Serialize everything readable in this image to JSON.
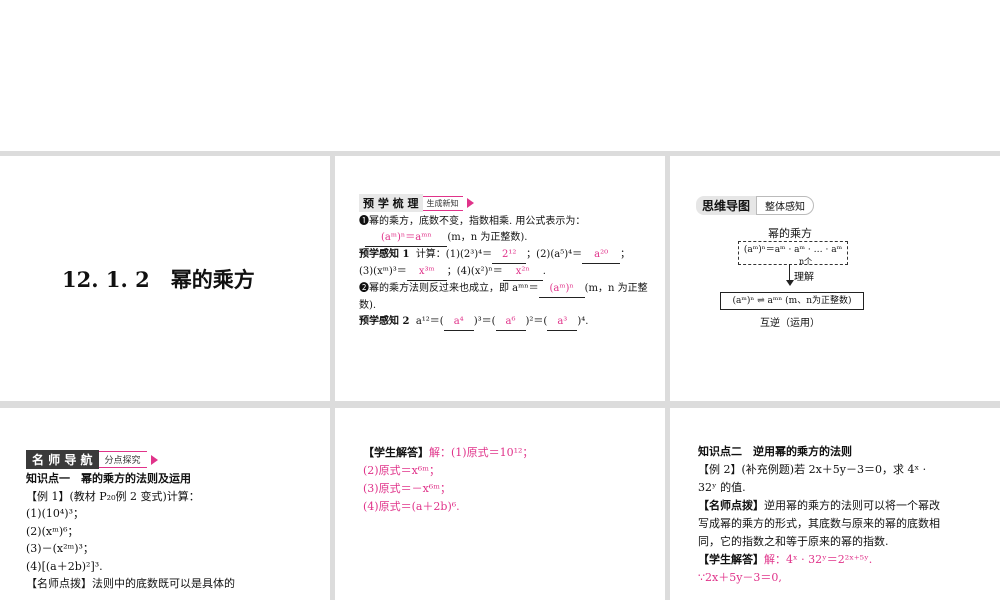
{
  "slide1": {
    "title": "12. 1. 2　幂的乘方"
  },
  "slide2": {
    "tag_main": "预 学 梳 理",
    "tag_sub": "生成新知",
    "point1": "❶幂的乘方，底数不变，指数相乘. 用公式表示为：",
    "formula_answer": "(aᵐ)ⁿ＝aᵐⁿ",
    "formula_cond": "(m，n 为正整数).",
    "p1_label": "预学感知 1",
    "p1_text": "计算：(1)(2³)⁴＝",
    "p1_a1": "2¹²",
    "p1_t2": "；(2)(a⁵)⁴＝",
    "p1_a2": "a²⁰",
    "p1_t3": "(3)(xᵐ)³＝",
    "p1_a3": "x³ᵐ",
    "p1_t4": "；(4)(x²)ⁿ＝",
    "p1_a4": "x²ⁿ",
    "point2": "❷幂的乘方法则反过来也成立，即 aᵐⁿ＝",
    "point2_a": "(aᵐ)ⁿ",
    "point2_cond": "(m，n 为正整数).",
    "p2_label": "预学感知 2",
    "p2_text": "a¹²＝(",
    "p2_a1": "a⁴",
    "p2_m1": ")³＝(",
    "p2_a2": "a⁶",
    "p2_m2": ")²＝(",
    "p2_a3": "a³",
    "p2_end": ")⁴."
  },
  "slide3": {
    "tag_main": "思维导图",
    "tag_sub": "整体感知",
    "heading": "幂的乘方",
    "box1": "(aᵐ)ⁿ＝aᵐ · aᵐ · … · aᵐ",
    "brace_label": "n个",
    "understand": "理解",
    "box2": "(aᵐ)ⁿ ⇌ aᵐⁿ (m、n为正整数)",
    "footer": "互逆（运用）"
  },
  "slide4": {
    "tag_main": "名 师 导 航",
    "tag_sub": "分点探究",
    "heading": "知识点一　幂的乘方的法则及运用",
    "example": "【例 1】(教材 P₂₀例 2 变式)计算：",
    "items": [
      "(1)(10⁴)³；",
      "(2)(xᵐ)⁶；",
      "(3)－(x²ᵐ)³；",
      "(4)[(a＋2b)²]³."
    ],
    "tip": "【名师点拨】法则中的底数既可以是具体的"
  },
  "slide5": {
    "label": "【学生解答】",
    "lines": [
      "解：(1)原式＝10¹²；",
      "(2)原式＝x⁶ᵐ；",
      "(3)原式＝－x⁶ᵐ；",
      "(4)原式＝(a＋2b)⁶."
    ]
  },
  "slide6": {
    "heading": "知识点二　逆用幂的乘方的法则",
    "example": "【例 2】(补充例题)若 2x＋5y－3＝0，求 4ˣ ·",
    "example2": "32ʸ 的值.",
    "tip_label": "【名师点拨】",
    "tip": "逆用幂的乘方的法则可以将一个幂改写成幂的乘方的形式，其底数与原来的幂的底数相同，它的指数之和等于原来的幂的指数.",
    "ans_label": "【学生解答】",
    "ans1": "解：4ˣ · 32ʸ＝2²ˣ⁺⁵ʸ.",
    "ans2": "∵2x＋5y－3＝0,"
  }
}
